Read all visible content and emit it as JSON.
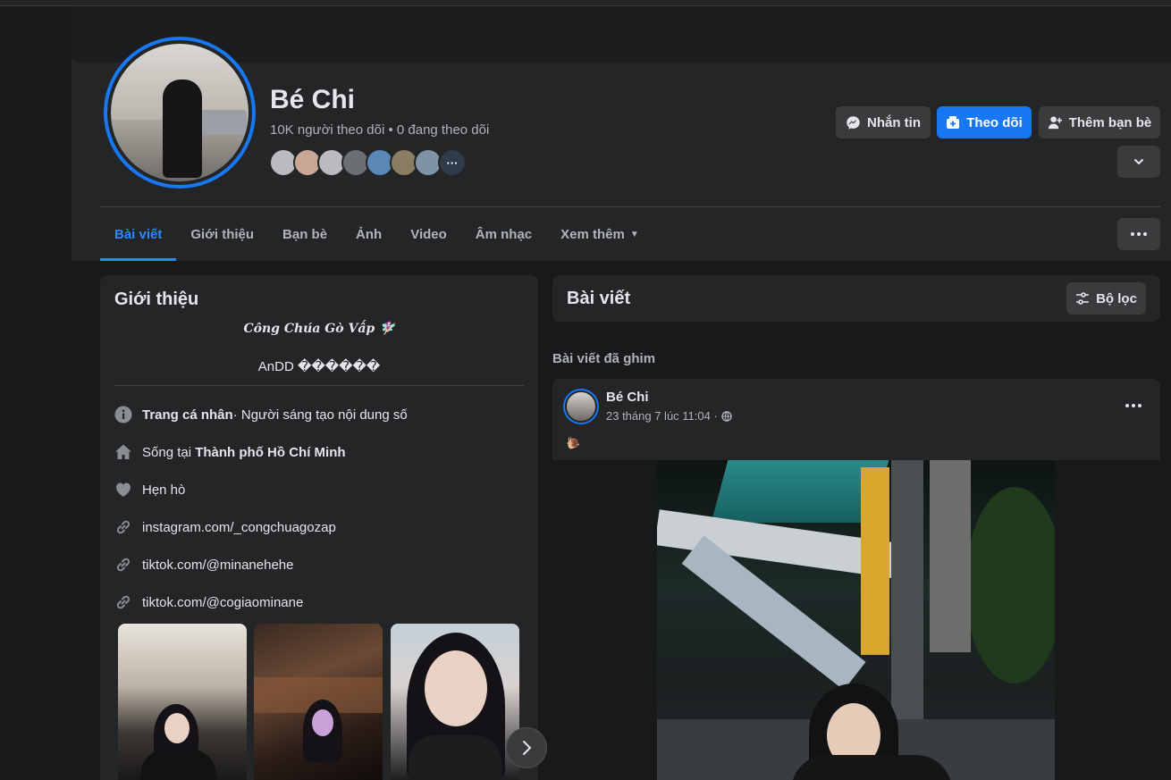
{
  "profile": {
    "name": "Bé Chi",
    "stats": "10K người theo dõi • 0 đang theo dõi",
    "mutual_more": "···",
    "friend_colors": [
      "#b9bbbe",
      "#c9a795",
      "#b9bbbe",
      "#6b6f74",
      "#5a87b5",
      "#8a7d62",
      "#7f93a6"
    ]
  },
  "actions": {
    "message": "Nhắn tin",
    "follow": "Theo dõi",
    "add_friend": "Thêm bạn bè"
  },
  "tabs": [
    {
      "label": "Bài viết",
      "active": true
    },
    {
      "label": "Giới thiệu",
      "active": false
    },
    {
      "label": "Bạn bè",
      "active": false
    },
    {
      "label": "Ảnh",
      "active": false
    },
    {
      "label": "Video",
      "active": false
    },
    {
      "label": "Âm nhạc",
      "active": false
    },
    {
      "label": "Xem thêm",
      "active": false
    }
  ],
  "intro": {
    "title": "Giới thiệu",
    "bio_line1": "𝑪𝒐̂𝒏𝒈 𝑪𝒉𝒖́𝒂 𝑮𝒐̀ 𝑽𝒂̂́𝒑 🧚🏻‍♀️",
    "bio_line2": "AnDD ������",
    "profile_label": "Trang cá nhân",
    "profile_value": " · Người sáng tạo nội dung số",
    "lives_prefix": "Sống tại ",
    "lives_city": "Thành phố Hồ Chí Minh",
    "dating": "Hẹn hò",
    "links": [
      "instagram.com/_congchuagozap",
      "tiktok.com/@minanehehe",
      "tiktok.com/@cogiaominane"
    ]
  },
  "posts": {
    "title": "Bài viết",
    "filter": "Bộ lọc",
    "pinned_label": "Bài viết đã ghim",
    "pinned": {
      "author": "Bé Chi",
      "time": "23 tháng 7 lúc 11:04 ·",
      "text": "🐌"
    }
  },
  "colors": {
    "accent": "#1877f2",
    "tab_active": "#2d88ff",
    "card": "#242526",
    "background": "#18191a"
  }
}
